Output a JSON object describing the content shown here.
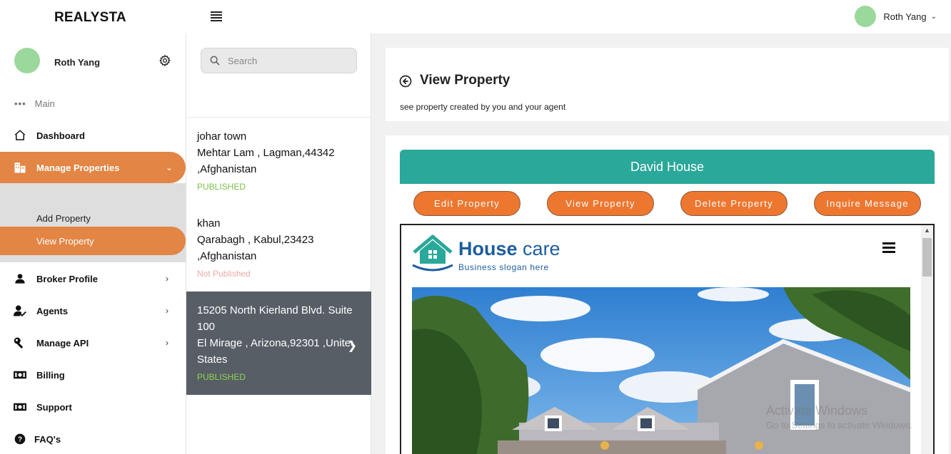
{
  "topbar": {
    "brand": "REALYSTA",
    "user_name": "Roth Yang"
  },
  "sidebar": {
    "profile_name": "Roth Yang",
    "section_label": "Main",
    "items": [
      {
        "label": "Dashboard"
      },
      {
        "label": "Manage Properties"
      },
      {
        "label": "Broker Profile"
      },
      {
        "label": "Agents"
      },
      {
        "label": "Manage API"
      },
      {
        "label": "Billing"
      },
      {
        "label": "Support"
      },
      {
        "label": "FAQ's"
      }
    ],
    "sub_items": [
      {
        "label": "Add Property"
      },
      {
        "label": "View Property"
      }
    ]
  },
  "list": {
    "search_placeholder": "Search",
    "properties": [
      {
        "line1": "johar town",
        "line2": "Mehtar Lam , Lagman,44342",
        "line3": ",Afghanistan",
        "status": "PUBLISHED"
      },
      {
        "line1": "khan",
        "line2": "Qarabagh , Kabul,23423",
        "line3": ",Afghanistan",
        "status": "Not Published"
      },
      {
        "line1": "15205 North Kierland Blvd. Suite",
        "line2": "100",
        "line3": "El Mirage , Arizona,92301 ,United",
        "line4": "States",
        "status": "PUBLISHED"
      }
    ]
  },
  "main": {
    "title": "View Property",
    "subtitle": "see property created by you and your agent",
    "property_name": "David House",
    "buttons": {
      "edit": "Edit Property",
      "view": "View Property",
      "delete": "Delete Property",
      "inquire": "Inquire Message"
    },
    "preview": {
      "logo_bold": "House",
      "logo_light": "care",
      "slogan": "Business slogan here"
    }
  },
  "watermark": {
    "line1": "Activate Windows",
    "line2": "Go to Settings to activate Windows."
  },
  "colors": {
    "accent": "#e38544",
    "teal": "#2aa89a",
    "button": "#ee7730",
    "selected_row": "#575e66",
    "published": "#7cc04b",
    "not_published": "#f0a8a8"
  }
}
